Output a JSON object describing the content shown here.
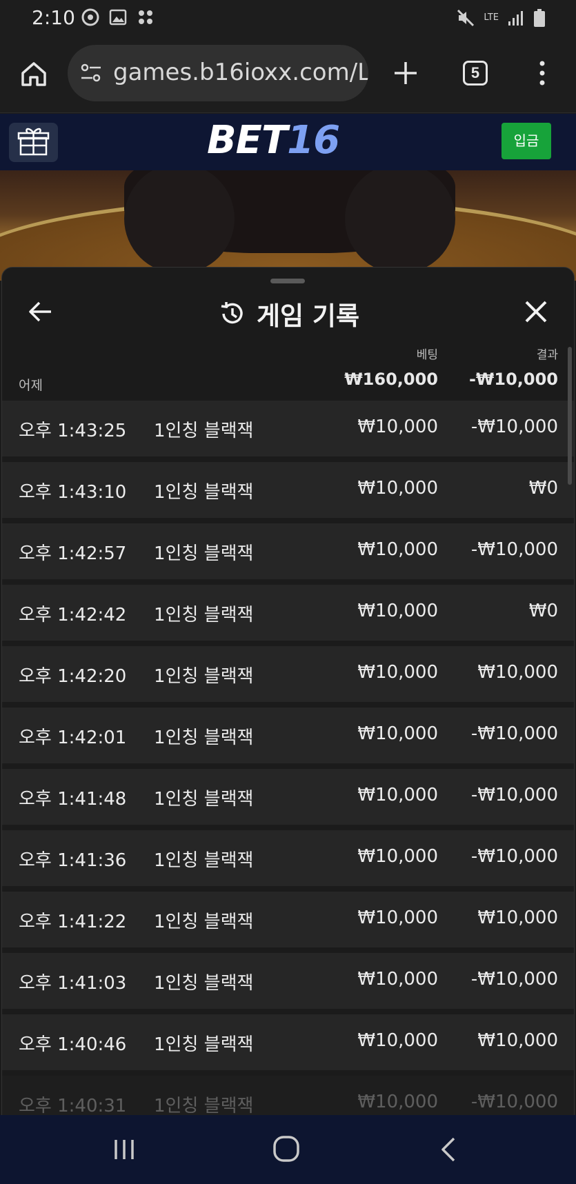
{
  "status_bar": {
    "time": "2:10",
    "network": "LTE"
  },
  "browser": {
    "url": "games.b16ioxx.com/L",
    "tab_count": "5"
  },
  "site": {
    "logo_text": "BET",
    "logo_number": "16",
    "deposit_label": "입금",
    "brand_color": "#0e1633",
    "deposit_color": "#17a33a"
  },
  "history": {
    "title": "게임 기록",
    "bet_label": "베팅",
    "result_label": "결과",
    "day_label": "어제",
    "bet_total": "₩160,000",
    "result_total": "-₩10,000",
    "rows": [
      {
        "time": "오후 1:43:25",
        "game": "1인칭 블랙잭",
        "bet": "₩10,000",
        "result": "-₩10,000"
      },
      {
        "time": "오후 1:43:10",
        "game": "1인칭 블랙잭",
        "bet": "₩10,000",
        "result": "₩0"
      },
      {
        "time": "오후 1:42:57",
        "game": "1인칭 블랙잭",
        "bet": "₩10,000",
        "result": "-₩10,000"
      },
      {
        "time": "오후 1:42:42",
        "game": "1인칭 블랙잭",
        "bet": "₩10,000",
        "result": "₩0"
      },
      {
        "time": "오후 1:42:20",
        "game": "1인칭 블랙잭",
        "bet": "₩10,000",
        "result": "₩10,000"
      },
      {
        "time": "오후 1:42:01",
        "game": "1인칭 블랙잭",
        "bet": "₩10,000",
        "result": "-₩10,000"
      },
      {
        "time": "오후 1:41:48",
        "game": "1인칭 블랙잭",
        "bet": "₩10,000",
        "result": "-₩10,000"
      },
      {
        "time": "오후 1:41:36",
        "game": "1인칭 블랙잭",
        "bet": "₩10,000",
        "result": "-₩10,000"
      },
      {
        "time": "오후 1:41:22",
        "game": "1인칭 블랙잭",
        "bet": "₩10,000",
        "result": "₩10,000"
      },
      {
        "time": "오후 1:41:03",
        "game": "1인칭 블랙잭",
        "bet": "₩10,000",
        "result": "-₩10,000"
      },
      {
        "time": "오후 1:40:46",
        "game": "1인칭 블랙잭",
        "bet": "₩10,000",
        "result": "₩10,000"
      },
      {
        "time": "오후 1:40:31",
        "game": "1인칭 블랙잭",
        "bet": "₩10,000",
        "result": "-₩10,000"
      }
    ]
  },
  "icons": {
    "home": "home-icon",
    "site_info": "tune-icon",
    "new_tab": "plus-icon",
    "tabs": "tabs-icon",
    "menu": "more-vert-icon",
    "gift": "gift-icon",
    "back": "arrow-left-icon",
    "history": "history-icon",
    "close": "close-icon",
    "nav_recent": "recent-apps-icon",
    "nav_home": "nav-home-icon",
    "nav_back": "nav-back-icon"
  }
}
